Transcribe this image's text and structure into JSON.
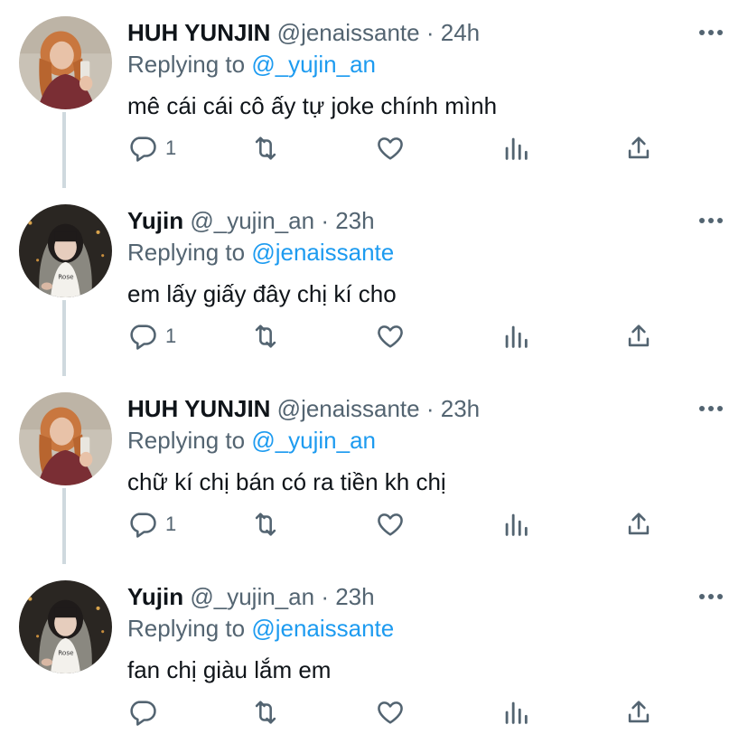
{
  "tweets": [
    {
      "name": "HUH YUNJIN",
      "handle": "@jenaissante",
      "dot": "·",
      "time": "24h",
      "replying_prefix": "Replying to",
      "replying_to": "@_yujin_an",
      "text": "mê cái cái cô ấy tự joke chính mình",
      "reply_count": "1",
      "avatar": "avatar-huh-yunjin"
    },
    {
      "name": "Yujin",
      "handle": "@_yujin_an",
      "dot": "·",
      "time": "23h",
      "replying_prefix": "Replying to",
      "replying_to": "@jenaissante",
      "text": "em lấy giấy đây chị kí cho",
      "reply_count": "1",
      "avatar": "avatar-yujin"
    },
    {
      "name": "HUH YUNJIN",
      "handle": "@jenaissante",
      "dot": "·",
      "time": "23h",
      "replying_prefix": "Replying to",
      "replying_to": "@_yujin_an",
      "text": "chữ kí chị bán có ra tiền kh chị",
      "reply_count": "1",
      "avatar": "avatar-huh-yunjin"
    },
    {
      "name": "Yujin",
      "handle": "@_yujin_an",
      "dot": "·",
      "time": "23h",
      "replying_prefix": "Replying to",
      "replying_to": "@jenaissante",
      "text": "fan chị giàu lắm em",
      "reply_count": "",
      "avatar": "avatar-yujin"
    }
  ],
  "icons": {
    "reply": "reply-icon",
    "retweet": "retweet-icon",
    "like": "like-icon",
    "views": "analytics-icon",
    "share": "share-icon",
    "more": "more-icon"
  },
  "colors": {
    "text": "#0f1419",
    "secondary": "#536471",
    "mention": "#1d9bf0",
    "thread_line": "#cfd9de"
  }
}
